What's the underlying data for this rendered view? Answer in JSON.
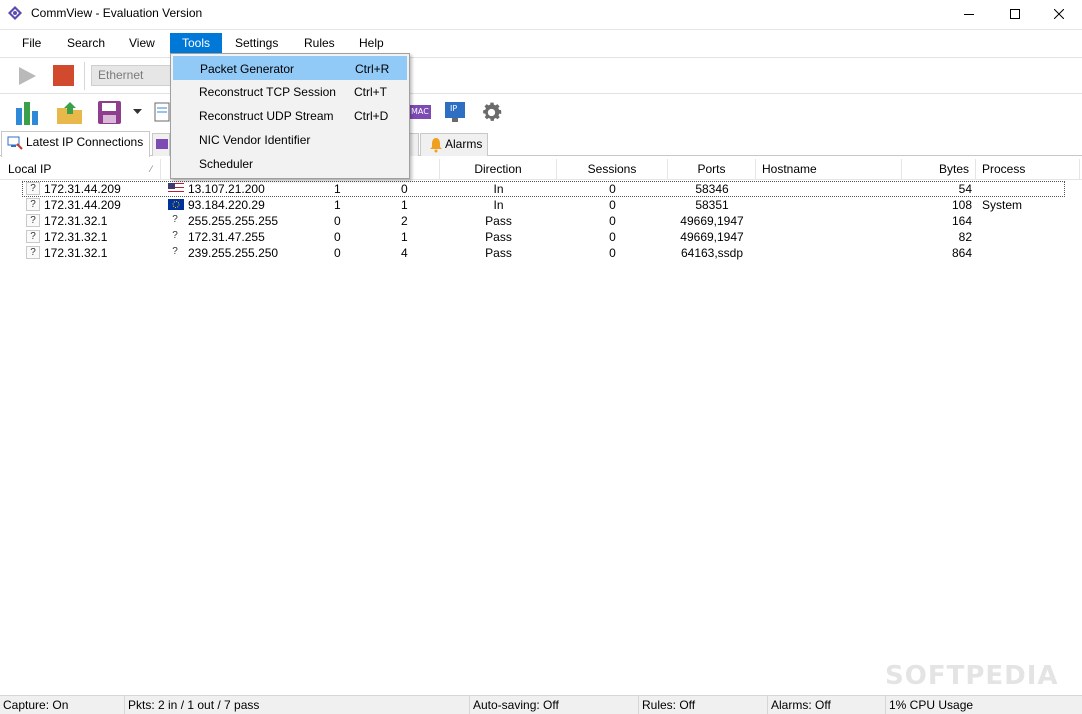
{
  "window": {
    "title": "CommView - Evaluation Version",
    "controls": [
      "minimize",
      "maximize",
      "close"
    ]
  },
  "menubar": {
    "items": [
      "File",
      "Search",
      "View",
      "Tools",
      "Settings",
      "Rules",
      "Help"
    ],
    "active": "Tools"
  },
  "toolbar": {
    "adapter_label": "Ethernet",
    "icons": [
      "play-icon",
      "stop-icon",
      "statistics-icon",
      "open-folder-icon",
      "save-icon",
      "mac-aliases-icon",
      "ip-aliases-icon",
      "settings-gear-icon"
    ],
    "mac_label": "MAC",
    "ip_label": "IP"
  },
  "tools_menu": {
    "items": [
      {
        "label": "Packet Generator",
        "shortcut": "Ctrl+R"
      },
      {
        "label": "Reconstruct TCP Session",
        "shortcut": "Ctrl+T"
      },
      {
        "label": "Reconstruct UDP Stream",
        "shortcut": "Ctrl+D"
      },
      {
        "label": "NIC Vendor Identifier",
        "shortcut": ""
      },
      {
        "label": "Scheduler",
        "shortcut": ""
      }
    ],
    "highlighted_index": 0
  },
  "tabs": {
    "active_label": "Latest IP Connections",
    "partial_label": "s",
    "alarms_label": "Alarms"
  },
  "table": {
    "columns": [
      "Local IP",
      "",
      "t",
      "Direction",
      "Sessions",
      "Ports",
      "Hostname",
      "Bytes",
      "Process"
    ],
    "rows": [
      {
        "local_ip": "172.31.44.209",
        "remote_ip": "13.107.21.200",
        "flag": "us",
        "in": "1",
        "out": "0",
        "direction": "In",
        "sessions": "0",
        "ports": "58346",
        "hostname": "",
        "bytes": "54",
        "process": ""
      },
      {
        "local_ip": "172.31.44.209",
        "remote_ip": "93.184.220.29",
        "flag": "eu",
        "in": "1",
        "out": "1",
        "direction": "In",
        "sessions": "0",
        "ports": "58351",
        "hostname": "",
        "bytes": "108",
        "process": "System"
      },
      {
        "local_ip": "172.31.32.1",
        "remote_ip": "255.255.255.255",
        "flag": "?",
        "in": "0",
        "out": "2",
        "direction": "Pass",
        "sessions": "0",
        "ports": "49669,1947",
        "hostname": "",
        "bytes": "164",
        "process": ""
      },
      {
        "local_ip": "172.31.32.1",
        "remote_ip": "172.31.47.255",
        "flag": "?",
        "in": "0",
        "out": "1",
        "direction": "Pass",
        "sessions": "0",
        "ports": "49669,1947",
        "hostname": "",
        "bytes": "82",
        "process": ""
      },
      {
        "local_ip": "172.31.32.1",
        "remote_ip": "239.255.255.250",
        "flag": "?",
        "in": "0",
        "out": "4",
        "direction": "Pass",
        "sessions": "0",
        "ports": "64163,ssdp",
        "hostname": "",
        "bytes": "864",
        "process": ""
      }
    ]
  },
  "statusbar": {
    "capture": "Capture: On",
    "packets": "Pkts: 2 in / 1 out / 7 pass",
    "autosaving": "Auto-saving: Off",
    "rules": "Rules: Off",
    "alarms": "Alarms: Off",
    "cpu": "1% CPU Usage"
  },
  "watermark": "SOFTPEDIA",
  "colors": {
    "menu_active": "#0078d7",
    "menu_highlight": "#91c9f7",
    "stop": "#d24a2e"
  }
}
